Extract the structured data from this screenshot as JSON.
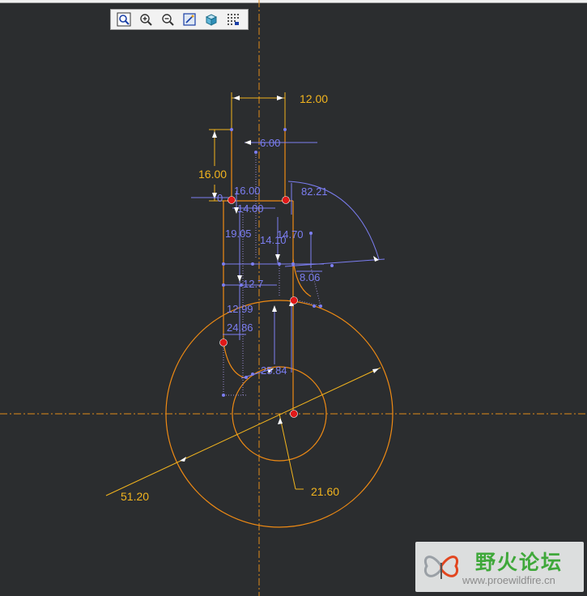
{
  "toolbar": {
    "buttons": [
      {
        "name": "refit-icon"
      },
      {
        "name": "zoom-in-icon"
      },
      {
        "name": "zoom-out-icon"
      },
      {
        "name": "repaint-icon"
      },
      {
        "name": "shading-icon"
      },
      {
        "name": "display-dimensions-icon"
      }
    ]
  },
  "dimensions": {
    "strong": {
      "d_12_00": "12.00",
      "d_16_00": "16.00",
      "d_51_20": "51.20",
      "d_21_60": "21.60"
    },
    "weak": {
      "d_6_00": "6.00",
      "d_16_00b": "16.00",
      "d_14_00": "14.00",
      "d_82_21": "82.21",
      "d_19_05": "19.05",
      "d_14_10": "14.10",
      "d_14_70": "14.70",
      "d_8_06": "8.06",
      "d_12_7": "12.7",
      "d_12_99": "12.99",
      "d_24_86": "24.86",
      "d_25_84": "25.84",
      "d_small": "0"
    }
  },
  "colors": {
    "background": "#2b2d2f",
    "geometry": "#ee8a14",
    "strong_dim": "#f2b41e",
    "weak_dim": "#7c7ef2",
    "centerline": "#e28a1a",
    "point": "#e01919"
  },
  "watermark": {
    "title": "野火论坛",
    "url": "www.proewildfire.cn"
  }
}
